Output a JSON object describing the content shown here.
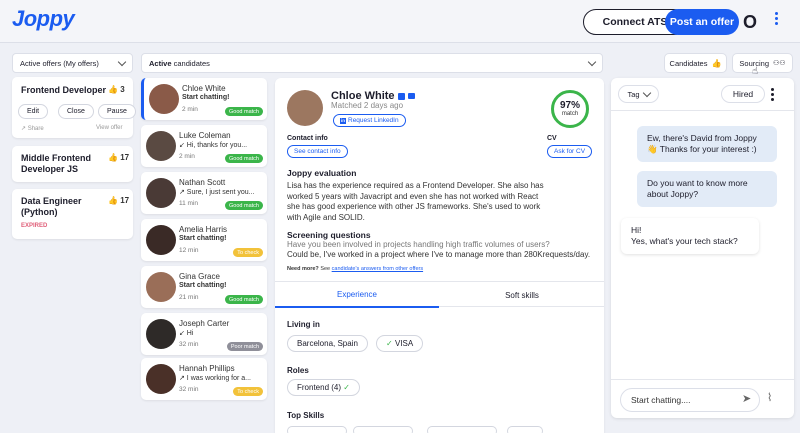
{
  "header": {
    "logo": "Joppy",
    "connect_ats": "Connect ATS",
    "post_offer": "Post an offer",
    "avatar_letter": "O"
  },
  "offers_dropdown": {
    "label": "Active offers (My offers)"
  },
  "candidates_dropdown": {
    "label_bold": "Active",
    "label_rest": " candidates"
  },
  "top_buttons": {
    "candidates": "Candidates",
    "sourcing": "Sourcing"
  },
  "offers": [
    {
      "title": "Frontend Developer",
      "count": "3",
      "edit": "Edit",
      "close": "Close",
      "pause": "Pause",
      "share": "Share",
      "view": "View offer"
    },
    {
      "title": "Middle Frontend Developer JS",
      "count": "17"
    },
    {
      "title": "Data Engineer (Python)",
      "count": "17",
      "status": "EXPIRED"
    }
  ],
  "candidates": [
    {
      "name": "Chloe White",
      "message": "Start chatting!",
      "time": "2 min",
      "badge": "Good match",
      "photo": "#8a5a48"
    },
    {
      "name": "Luke Coleman",
      "message": "↙ Hi, thanks for you...",
      "time": "2 min",
      "badge": "Good match",
      "photo": "#5a4a42"
    },
    {
      "name": "Nathan Scott",
      "message": "↗ Sure, I just sent you...",
      "time": "11 min",
      "badge": "Good match",
      "photo": "#4a3a36"
    },
    {
      "name": "Amelia Harris",
      "message": "Start chatting!",
      "time": "12 min",
      "badge": "To check",
      "photo": "#3a2a26"
    },
    {
      "name": "Gina Grace",
      "message": "Start chatting!",
      "time": "21 min",
      "badge": "Good match",
      "photo": "#9a6e58"
    },
    {
      "name": "Joseph Carter",
      "message": "↙ Hi",
      "time": "32 min",
      "badge": "Poor match",
      "photo": "#2e2a28"
    },
    {
      "name": "Hannah Phillips",
      "message": "↗ I was working for a...",
      "time": "32 min",
      "badge": "To check",
      "photo": "#4a3028"
    }
  ],
  "detail": {
    "name": "Chloe White",
    "matched": "Matched 2 days ago",
    "linkedin": "Request LinkedIn",
    "match_pct": "97%",
    "match_label": "match",
    "contact_label": "Contact info",
    "contact_btn": "See contact info",
    "cv_label": "CV",
    "cv_btn": "Ask for CV",
    "eval_title": "Joppy evaluation",
    "eval_text": "Lisa has the experience required as a Frontend Developer. She also has worked 5 years with Javacript and even she has not worked with React she has good experience with other JS frameworks. She's used to work with Agile and SOLID.",
    "screen_title": "Screening questions",
    "screen_q": "Have you been involved in projects handling high traffic volumes of users?",
    "screen_a": "Could be, I've worked in a project where I've to manage more than 280Krequests/day.",
    "more_bold": "Need more?",
    "more_text": " See ",
    "more_link": "candidate's answers from other offers",
    "tab_experience": "Experience",
    "tab_soft": "Soft skills",
    "living_title": "Living in",
    "living_city": "Barcelona, Spain",
    "living_visa": "VISA",
    "roles_title": "Roles",
    "role_chip": "Frontend (4)",
    "skills_title": "Top Skills"
  },
  "chat": {
    "tag": "Tag",
    "hired": "Hired",
    "msg1": "Ew, there's David from Joppy 👋 Thanks for your interest :)",
    "msg2": "Do you want to know more about Joppy?",
    "msg3a": "Hi!",
    "msg3b": "Yes, what's your tech stack?",
    "input_placeholder": "Start chatting....",
    "send_icon": "send-icon",
    "attach_icon": "paperclip-icon"
  },
  "colors": {
    "brand": "#1b5cf0",
    "good": "#3bb54a",
    "tocheck": "#f2c23a",
    "poor": "#8f8f99"
  }
}
